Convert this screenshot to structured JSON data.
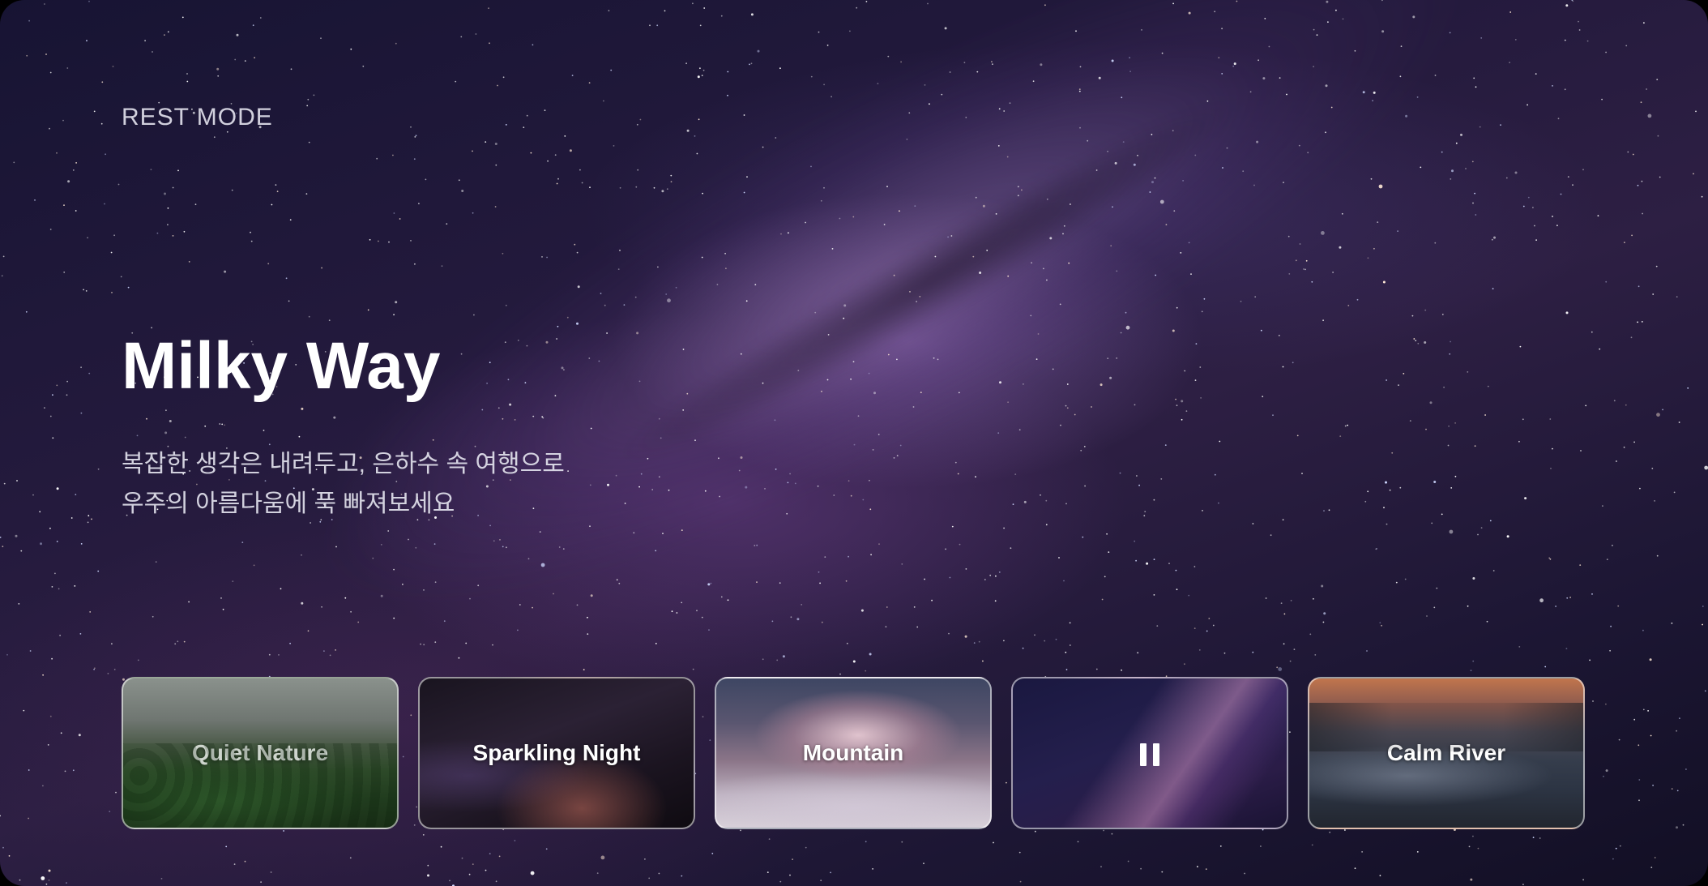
{
  "header": {
    "mode_label": "REST MODE"
  },
  "hero": {
    "title": "Milky Way",
    "subtitle_lines": [
      "복잡한 생각은 내려두고, 은하수 속 여행으로",
      "우주의 아름다움에 푹 빠져보세요"
    ]
  },
  "cards": [
    {
      "label": "Quiet Nature",
      "state": "idle"
    },
    {
      "label": "Sparkling Night",
      "state": "idle"
    },
    {
      "label": "Mountain",
      "state": "idle"
    },
    {
      "label": "",
      "state": "playing",
      "icon": "pause-icon"
    },
    {
      "label": "Calm River",
      "state": "idle"
    }
  ],
  "colors": {
    "text_primary": "#ffffff",
    "card_border": "#ffffff"
  }
}
